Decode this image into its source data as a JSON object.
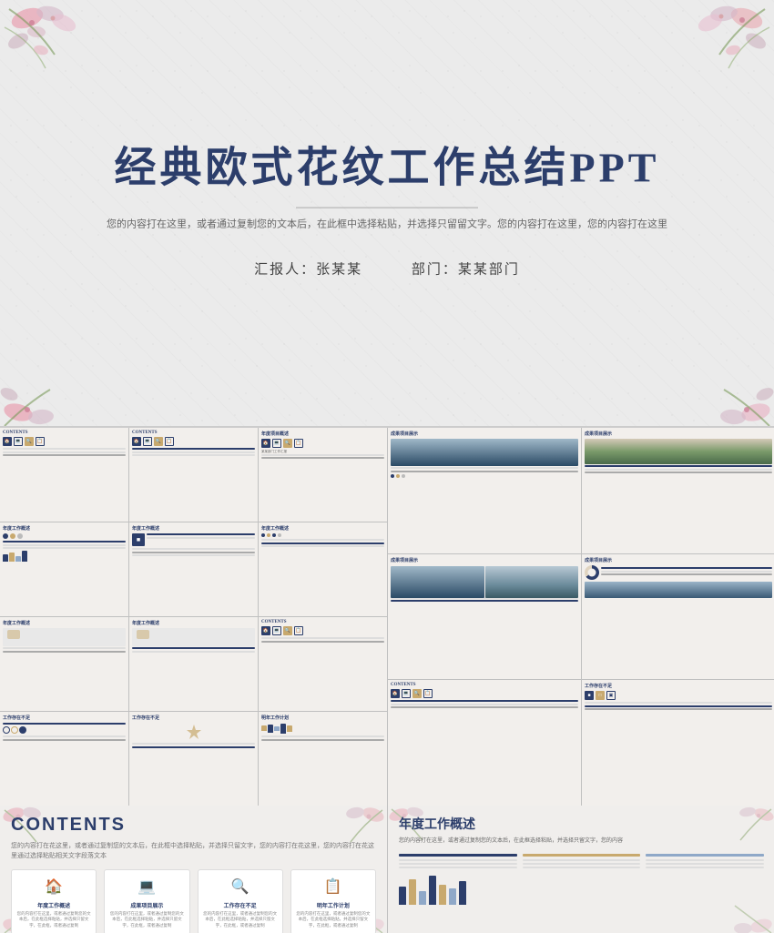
{
  "title_slide": {
    "main_title": "经典欧式花纹工作总结PPT",
    "subtitle": "您的内容打在这里，或者通过复制您的文本后，在此框中选择粘贴，并选择只留留文字。您的内容打在这里，您的内容打在这里",
    "reporter_label": "汇报人：张某某",
    "dept_label": "部门：某某部门"
  },
  "contents_slide": {
    "label": "CONTENTS",
    "subtitle": "您的内容打在花这里，或者通过复制您的文本后，在此框中选择粘贴，并选择只留文字，您的内容打在花这里，您的内容打在花这里通过选择粘贴相关文字段落文本以内容展示此处",
    "items": [
      {
        "icon": "🏠",
        "title": "年度工作概述",
        "text": "您的内容打在这里，或者通过复制您的文本后，在此框选择粘贴，并选择只留文字，在此框，或者通过复制"
      },
      {
        "icon": "💻",
        "title": "成果项目展示",
        "text": "您的内容打在这里，或者通过复制您的文本后，在此框选择粘贴，并选择只留文字，在此框，或者通过复制"
      },
      {
        "icon": "🔍",
        "title": "工作存在不足",
        "text": "您的内容打在这里，或者通过复制您的文本后，在此框选择粘贴，并选择只留文字，在此框，或者通过复制"
      },
      {
        "icon": "📋",
        "title": "明年工作计划",
        "text": "您的内容打在这里，或者通过复制您的文本后，在此框选择粘贴，并选择只留文字，在此框，或者通过复制"
      }
    ]
  },
  "nian_du_slide": {
    "title": "年度工作概述",
    "text": "您的内容打在这里，或者通过复制您的文本后，在此框选择粘贴，并选择只留文字，您的内容打在这里"
  },
  "bottom_left": {
    "label": "CONTENTS",
    "subtitle": "您的内容打在花这里，或者通过复制您的文本后，在此框中选择粘贴，并选择只留文字，您的内容打在花这里，您的内容打在花这里通过选择粘贴相关文字段落文本"
  },
  "bottom_right": {
    "label": "年度工作概述",
    "subtitle": "您的内容打在这里，或者通过复制您的文本后，在此框选择粘贴，并选择只留文字，您的内容"
  }
}
